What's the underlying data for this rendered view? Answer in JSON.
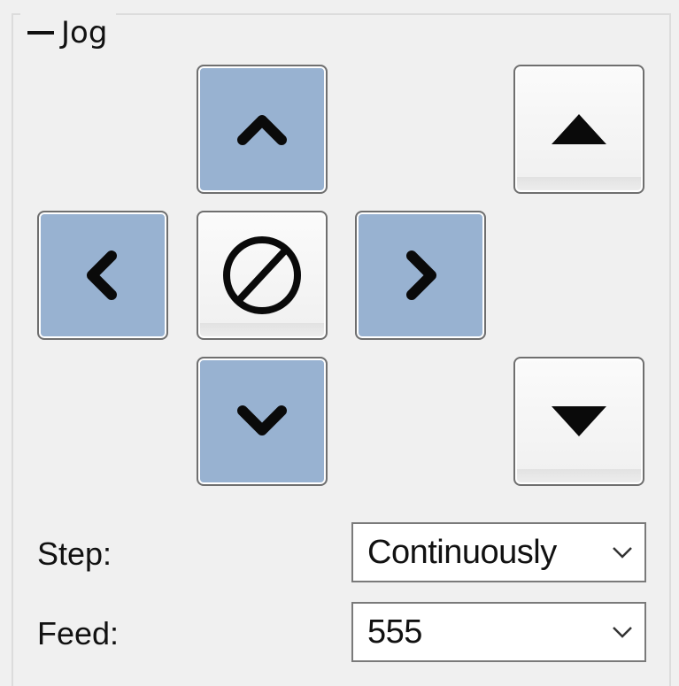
{
  "jog_group": {
    "title": "Jog",
    "collapse_icon": "minus-icon"
  },
  "jog_buttons": {
    "y_plus": {
      "icon": "chevron-up-icon",
      "color": "#98b2d1"
    },
    "y_minus": {
      "icon": "chevron-down-icon",
      "color": "#98b2d1"
    },
    "x_minus": {
      "icon": "chevron-left-icon",
      "color": "#98b2d1"
    },
    "x_plus": {
      "icon": "chevron-right-icon",
      "color": "#98b2d1"
    },
    "stop": {
      "icon": "stop-circle-slash-icon"
    },
    "z_plus": {
      "icon": "triangle-up-icon"
    },
    "z_minus": {
      "icon": "triangle-down-icon"
    }
  },
  "step": {
    "label": "Step:",
    "value": "Continuously"
  },
  "feed": {
    "label": "Feed:",
    "value": "555"
  }
}
